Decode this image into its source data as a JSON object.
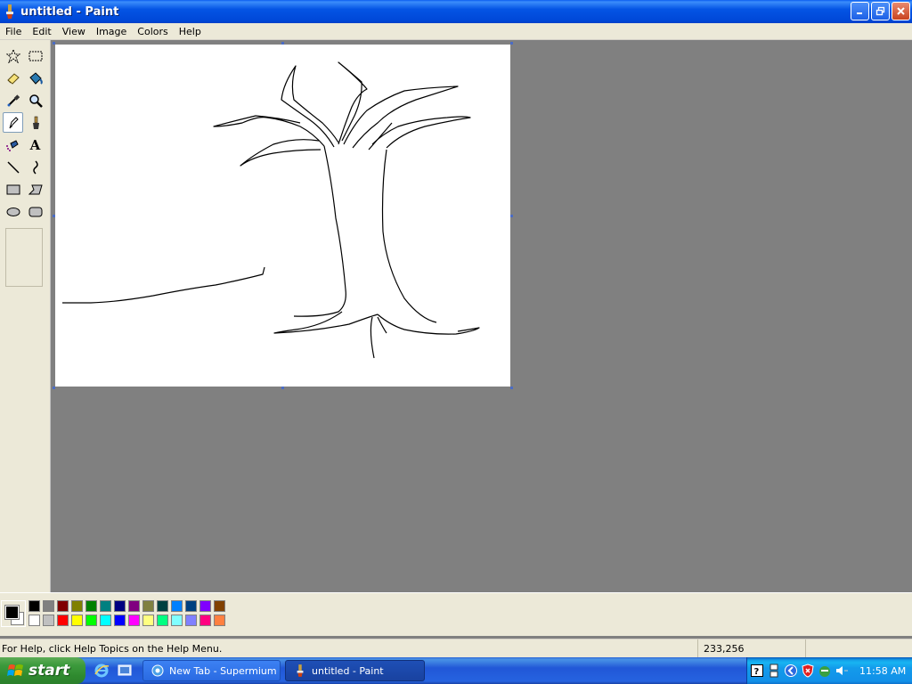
{
  "window": {
    "title": "untitled - Paint"
  },
  "menu": [
    "File",
    "Edit",
    "View",
    "Image",
    "Colors",
    "Help"
  ],
  "tools": [
    {
      "name": "free-form-select"
    },
    {
      "name": "select"
    },
    {
      "name": "eraser"
    },
    {
      "name": "fill-with-color"
    },
    {
      "name": "pick-color"
    },
    {
      "name": "magnifier"
    },
    {
      "name": "pencil",
      "selected": true
    },
    {
      "name": "brush"
    },
    {
      "name": "airbrush"
    },
    {
      "name": "text"
    },
    {
      "name": "line"
    },
    {
      "name": "curve"
    },
    {
      "name": "rectangle"
    },
    {
      "name": "polygon"
    },
    {
      "name": "ellipse"
    },
    {
      "name": "rounded-rectangle"
    }
  ],
  "text_tool_glyph": "A",
  "colors": {
    "foreground": "#000000",
    "background": "#ffffff",
    "palette_row1": [
      "#000000",
      "#808080",
      "#800000",
      "#808000",
      "#008000",
      "#008080",
      "#000080",
      "#800080",
      "#808040",
      "#004040",
      "#0080ff",
      "#004080",
      "#8000ff",
      "#804000"
    ],
    "palette_row2": [
      "#ffffff",
      "#c0c0c0",
      "#ff0000",
      "#ffff00",
      "#00ff00",
      "#00ffff",
      "#0000ff",
      "#ff00ff",
      "#ffff80",
      "#00ff80",
      "#80ffff",
      "#8080ff",
      "#ff0080",
      "#ff8040"
    ]
  },
  "status": {
    "help_text": "For Help, click Help Topics on the Help Menu.",
    "coordinates": "233,256"
  },
  "taskbar": {
    "start_label": "start",
    "tasks": [
      {
        "label": "New Tab - Supermium",
        "active": false
      },
      {
        "label": "untitled - Paint",
        "active": true
      }
    ],
    "clock": "11:58 AM"
  }
}
